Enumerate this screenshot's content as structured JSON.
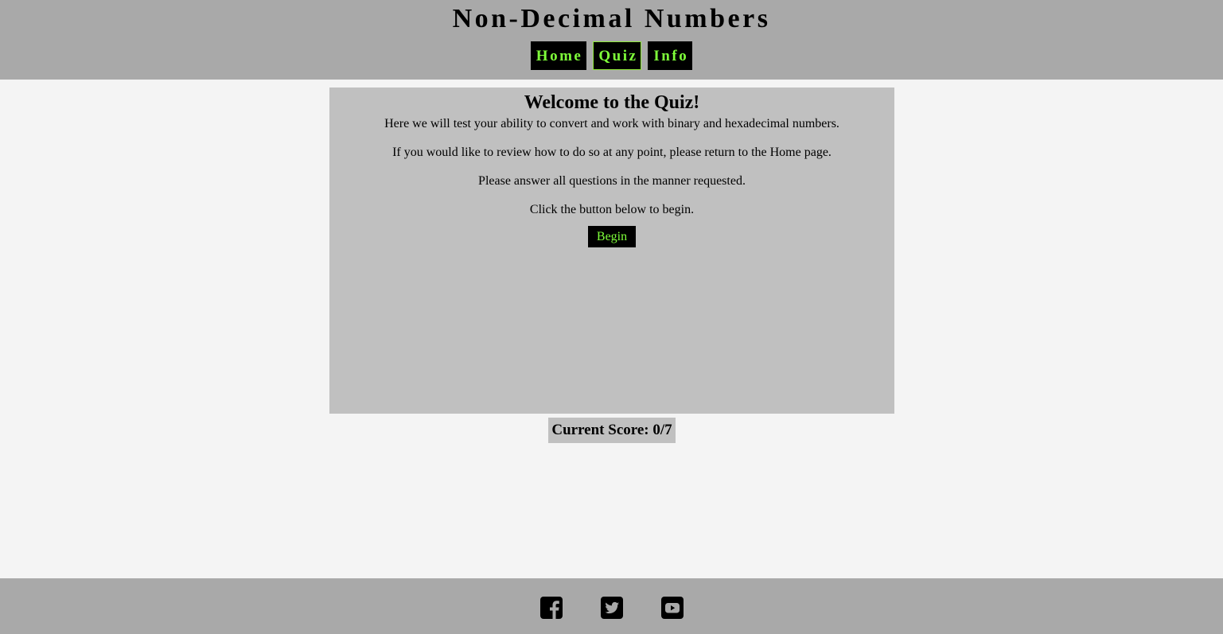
{
  "header": {
    "title": "Non-Decimal Numbers",
    "nav": [
      {
        "label": "Home",
        "active": false
      },
      {
        "label": "Quiz",
        "active": true
      },
      {
        "label": "Info",
        "active": false
      }
    ]
  },
  "quiz": {
    "title": "Welcome to the Quiz!",
    "paragraphs": [
      "Here we will test your ability to convert and work with binary and hexadecimal numbers.",
      "If you would like to review how to do so at any point, please return to the Home page.",
      "Please answer all questions in the manner requested.",
      "Click the button below to begin."
    ],
    "begin_label": "Begin"
  },
  "score": {
    "text": "Current Score: 0/7"
  },
  "footer": {
    "social_icons": [
      "facebook-icon",
      "twitter-icon",
      "youtube-icon"
    ]
  },
  "colors": {
    "header_bg": "#a9a9a9",
    "page_bg": "#f4f4f4",
    "panel_bg": "#c0c0c0",
    "button_bg": "#000000",
    "accent_text": "#7fff3a"
  }
}
